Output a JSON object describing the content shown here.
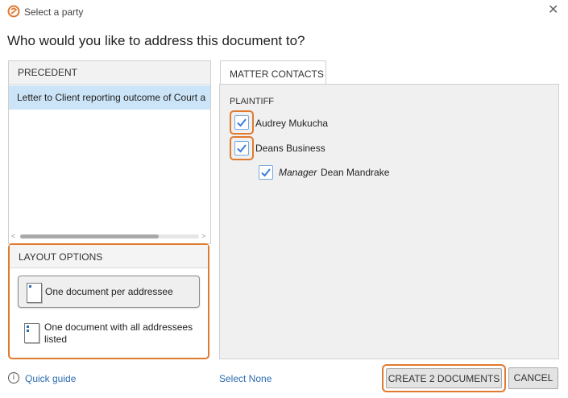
{
  "window": {
    "title": "Select a party"
  },
  "heading": "Who would you like to address this document to?",
  "precedent": {
    "header": "PRECEDENT",
    "items": [
      {
        "label": "Letter to Client reporting outcome of Court a"
      }
    ]
  },
  "layout_options": {
    "header": "LAYOUT OPTIONS",
    "options": [
      {
        "label": "One document per addressee",
        "selected": true
      },
      {
        "label": "One document with all addressees listed",
        "selected": false
      }
    ]
  },
  "matter_contacts": {
    "tab_label": "MATTER CONTACTS",
    "group_label": "PLAINTIFF",
    "contacts": [
      {
        "name": "Audrey Mukucha",
        "checked": true
      },
      {
        "name": "Deans Business",
        "checked": true
      },
      {
        "role": "Manager",
        "name": "Dean Mandrake",
        "checked": true
      }
    ]
  },
  "footer": {
    "quick_guide": "Quick guide",
    "select_none": "Select None",
    "create_label": "CREATE 2 DOCUMENTS",
    "cancel_label": "CANCEL"
  },
  "colors": {
    "accent": "#e07a2f",
    "link": "#2b6cb0",
    "check": "#3b7ddd",
    "selection": "#cce4f7"
  }
}
